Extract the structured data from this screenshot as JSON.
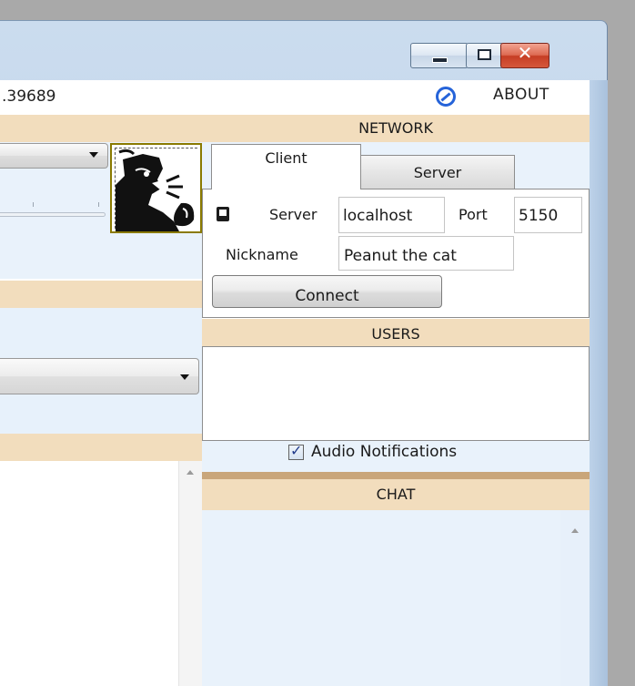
{
  "window": {
    "title_fragment": ".39689",
    "about_label": "ABOUT",
    "colors": {
      "band": "#f2ddbd",
      "light_panel": "#e9f2fb",
      "accent_blue": "#2563d9"
    }
  },
  "network": {
    "header": "NETWORK",
    "tabs": [
      {
        "label": "Client",
        "selected": true
      },
      {
        "label": "Server",
        "selected": false
      }
    ],
    "server_label": "Server",
    "server_value": "localhost",
    "port_label": "Port",
    "port_value": "5150",
    "nickname_label": "Nickname",
    "nickname_value": "Peanut the cat",
    "connect_label": "Connect"
  },
  "users": {
    "header": "USERS"
  },
  "notifications": {
    "label": "Audio Notifications",
    "checked": true
  },
  "chat": {
    "header": "CHAT"
  },
  "icons": [
    "minimize-icon",
    "maximize-icon",
    "close-icon",
    "about-icon",
    "book-icon",
    "combo-arrow-icon",
    "scroll-up-icon"
  ]
}
